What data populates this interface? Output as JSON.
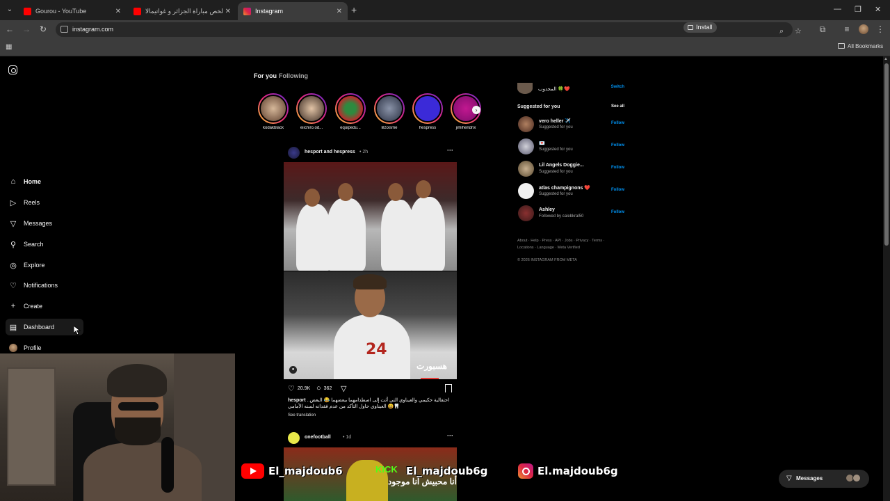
{
  "browser": {
    "tabs": [
      {
        "title": "Gourou - YouTube",
        "icon": "youtube-icon"
      },
      {
        "title": "ملخص مباراة الجزائر و غواتيمالا | ...",
        "icon": "youtube-icon"
      },
      {
        "title": "Instagram",
        "icon": "instagram-icon",
        "active": true
      }
    ],
    "url": "instagram.com",
    "install_label": "Install",
    "all_bookmarks": "All Bookmarks"
  },
  "nav": {
    "items": [
      {
        "label": "Home",
        "icon": "home-icon"
      },
      {
        "label": "Reels",
        "icon": "reels-icon"
      },
      {
        "label": "Messages",
        "icon": "messages-icon"
      },
      {
        "label": "Search",
        "icon": "search-icon"
      },
      {
        "label": "Explore",
        "icon": "explore-icon"
      },
      {
        "label": "Notifications",
        "icon": "heart-icon"
      },
      {
        "label": "Create",
        "icon": "plus-icon"
      },
      {
        "label": "Dashboard",
        "icon": "dashboard-icon"
      },
      {
        "label": "Profile",
        "icon": "avatar"
      }
    ]
  },
  "feed": {
    "tab_for_you": "For you",
    "tab_following": "Following",
    "stories": [
      "kodakblack",
      "eiichiro.od...",
      "equipedu...",
      "lilzoisme",
      "hespress",
      "jimihendrix"
    ],
    "post1": {
      "authors": "hesport and hespress",
      "time": "• 2h",
      "likes": "20.9K",
      "comments": "362",
      "caption_user": "hesport",
      "caption": "احتفالية حكيمي والعيناوي التي أثت إلى اصطدامهما ببعضهما 😂 البعض.. العيناوي حاول التأكد من عدم فقدانه لسنه الأمامي 😄🦷",
      "see_translation": "See translation",
      "jersey_number": "24",
      "watermark": "هسبورت"
    },
    "post2": {
      "author": "onefootball",
      "time": "• 1d",
      "kick_label": "KICK"
    }
  },
  "sidebar": {
    "me_name": "المجدوب 🍀❤️",
    "switch": "Switch",
    "suggested_title": "Suggested for you",
    "see_all": "See all",
    "suggestions": [
      {
        "name": "vero heller ✈️",
        "sub": "Suggested for you",
        "follow": "Follow"
      },
      {
        "name": "💌",
        "sub": "Suggested for you",
        "follow": "Follow"
      },
      {
        "name": "Lil Angels Doggie...",
        "sub": "Suggested for you",
        "follow": "Follow"
      },
      {
        "name": "atlas champignons ❤️",
        "sub": "Suggested for you",
        "follow": "Follow"
      },
      {
        "name": "Ashley",
        "sub": "Followed by calebkral50",
        "follow": "Follow"
      }
    ],
    "footer_links": "About · Help · Press · API · Jobs · Privacy · Terms · Locations · Language · Meta Verified",
    "copyright": "© 2026 INSTAGRAM FROM META"
  },
  "messages_pill": "Messages",
  "overlay": {
    "youtube_handle": "El_majdoub6",
    "kick_handle": "El_majdoub6g",
    "kick_subtitle": "أنا محبيش أنا موجود",
    "instagram_handle": "El.majdoub6g"
  }
}
